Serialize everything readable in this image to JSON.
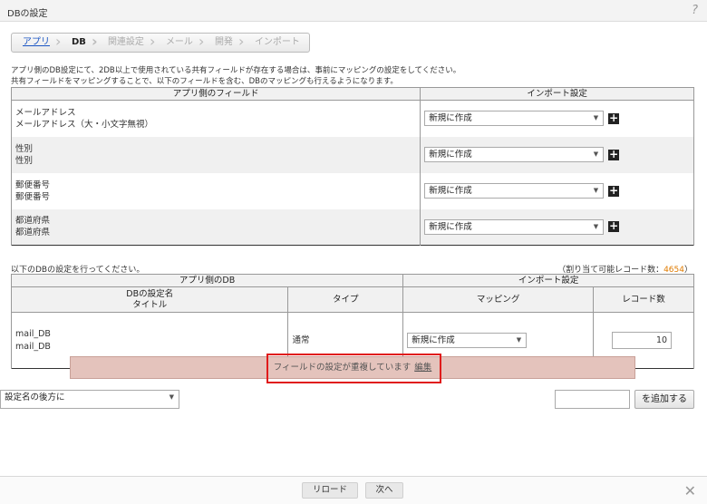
{
  "window": {
    "title": "DBの設定",
    "help_symbol": "?"
  },
  "steps": [
    {
      "label": "アプリ"
    },
    {
      "label": "DB"
    },
    {
      "label": "関連設定"
    },
    {
      "label": "メール"
    },
    {
      "label": "開発"
    },
    {
      "label": "インポート"
    }
  ],
  "description": {
    "line1": "アプリ側のDB設定にて、2DB以上で使用されている共有フィールドが存在する場合は、事前にマッピングの設定をしてください。",
    "line2": "共有フィールドをマッピングすることで、以下のフィールドを含む、DBのマッピングも行えるようになります。"
  },
  "field_table": {
    "col_app_field": "アプリ側のフィールド",
    "col_import": "インポート設定",
    "rows": [
      {
        "line1": "メールアドレス",
        "line2": "メールアドレス（大・小文字無視）",
        "select": "新規に作成"
      },
      {
        "line1": "性別",
        "line2": "性別",
        "select": "新規に作成"
      },
      {
        "line1": "郵便番号",
        "line2": "郵便番号",
        "select": "新規に作成"
      },
      {
        "line1": "都道府県",
        "line2": "都道府県",
        "select": "新規に作成"
      }
    ]
  },
  "db_section": {
    "caption": "以下のDBの設定を行ってください。",
    "quota_label": "（割り当て可能レコード数：",
    "quota_value": "4654",
    "quota_close": "）",
    "col_app_db": "アプリ側のDB",
    "col_import": "インポート設定",
    "col_db_setting_name": "DBの設定名",
    "col_title": "タイトル",
    "col_type": "タイプ",
    "col_mapping": "マッピング",
    "col_record_count": "レコード数",
    "row": {
      "name": "mail_DB",
      "title": "mail_DB",
      "type": "通常",
      "mapping": "新規に作成",
      "record_count": "10"
    }
  },
  "error": {
    "message": "フィールドの設定が重複しています",
    "edit_link": "編集"
  },
  "add_row": {
    "position_select": "設定名の後方に",
    "name_value": "",
    "add_button": "を追加する"
  },
  "footer": {
    "reload_button": "リロード",
    "next_button": "次へ",
    "close_symbol": "✕"
  },
  "icons": {
    "plus": "+",
    "dropdown_arrow": "▼"
  }
}
